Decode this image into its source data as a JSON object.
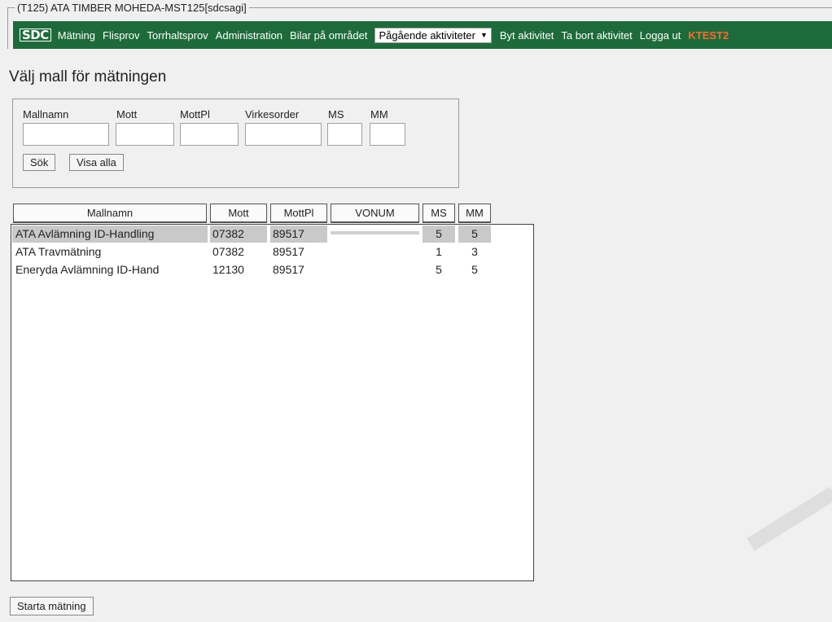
{
  "window": {
    "legend": "(T125) ATA TIMBER MOHEDA-MST125[sdcsagi]"
  },
  "nav": {
    "logo": "SDC",
    "items": [
      "Mätning",
      "Flisprov",
      "Torrhaltsprov",
      "Administration",
      "Bilar på området"
    ],
    "activity_select": "Pågående aktiviteter",
    "actions": [
      "Byt aktivitet",
      "Ta bort aktivitet",
      "Logga ut"
    ],
    "user": "KTEST2",
    "colors": {
      "bar": "#1d6b3a",
      "user": "#ff6a2a"
    }
  },
  "page": {
    "title": "Välj mall för mätningen"
  },
  "search": {
    "labels": {
      "mallnamn": "Mallnamn",
      "mott": "Mott",
      "mottpl": "MottPl",
      "virkesorder": "Virkesorder",
      "ms": "MS",
      "mm": "MM"
    },
    "values": {
      "mallnamn": "",
      "mott": "",
      "mottpl": "",
      "virkesorder": "",
      "ms": "",
      "mm": ""
    },
    "search_button": "Sök",
    "show_all_button": "Visa alla"
  },
  "table": {
    "columns": [
      "Mallnamn",
      "Mott",
      "MottPl",
      "VONUM",
      "MS",
      "MM"
    ],
    "rows": [
      {
        "mallnamn": "ATA Avlämning ID-Handling",
        "mott": "07382",
        "mottpl": "89517",
        "vonum": "",
        "ms": "5",
        "mm": "5",
        "selected": true
      },
      {
        "mallnamn": "ATA Travmätning",
        "mott": "07382",
        "mottpl": "89517",
        "vonum": "",
        "ms": "1",
        "mm": "3",
        "selected": false
      },
      {
        "mallnamn": "Eneryda Avlämning ID-Hand",
        "mott": "12130",
        "mottpl": "89517",
        "vonum": "",
        "ms": "5",
        "mm": "5",
        "selected": false
      }
    ]
  },
  "footer": {
    "start_button": "Starta mätning"
  }
}
